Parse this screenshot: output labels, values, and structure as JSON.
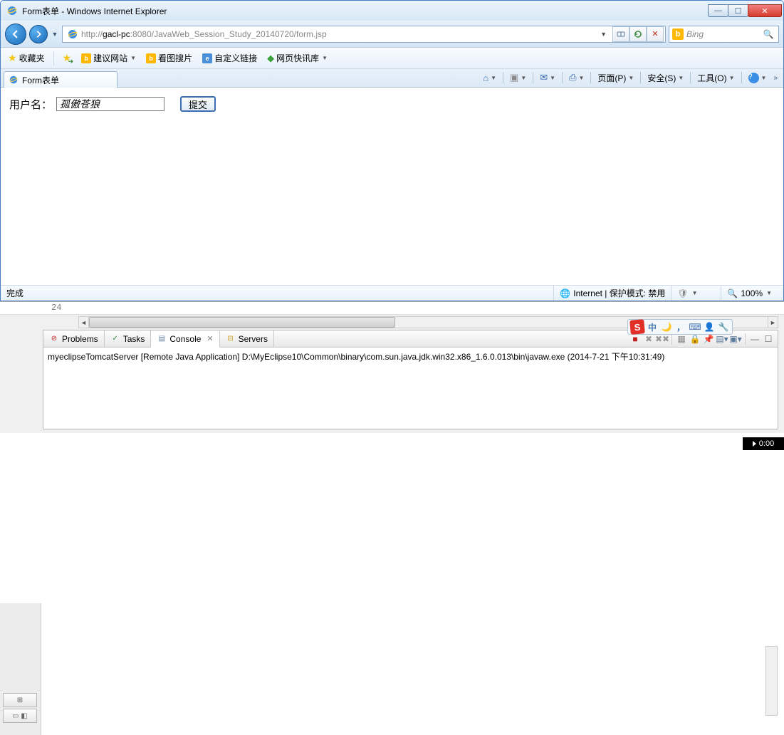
{
  "window": {
    "title": "Form表单 - Windows Internet Explorer"
  },
  "address": {
    "prefix": "http://",
    "host": "gacl-pc",
    "port": ":8080",
    "path": "/JavaWeb_Session_Study_20140720/form.jsp"
  },
  "search": {
    "engine": "b",
    "placeholder": "Bing"
  },
  "favorites": {
    "label": "收藏夹",
    "items": [
      {
        "label": "建议网站",
        "hasDrop": true
      },
      {
        "label": "看图搜片",
        "hasDrop": false
      },
      {
        "label": "自定义链接",
        "hasDrop": false
      },
      {
        "label": "网页快讯库",
        "hasDrop": true
      }
    ]
  },
  "tab": {
    "title": "Form表单"
  },
  "commandbar": {
    "page": "页面(P)",
    "safety": "安全(S)",
    "tools": "工具(O)"
  },
  "form": {
    "label": "用户名：",
    "value": "孤傲苍狼",
    "submit": "提交"
  },
  "status": {
    "left": "完成",
    "zone": "Internet | 保护模式: 禁用",
    "zoom": "100%"
  },
  "eclipse": {
    "lineNum": "24",
    "tabs": {
      "problems": "Problems",
      "tasks": "Tasks",
      "console": "Console",
      "servers": "Servers"
    },
    "consoleLine": "myeclipseTomcatServer [Remote Java Application] D:\\MyEclipse10\\Common\\binary\\com.sun.java.jdk.win32.x86_1.6.0.013\\bin\\javaw.exe (2014-7-21 下午10:31:49)"
  },
  "ime": {
    "s": "S",
    "zhong": "中"
  },
  "clock": "0:00"
}
